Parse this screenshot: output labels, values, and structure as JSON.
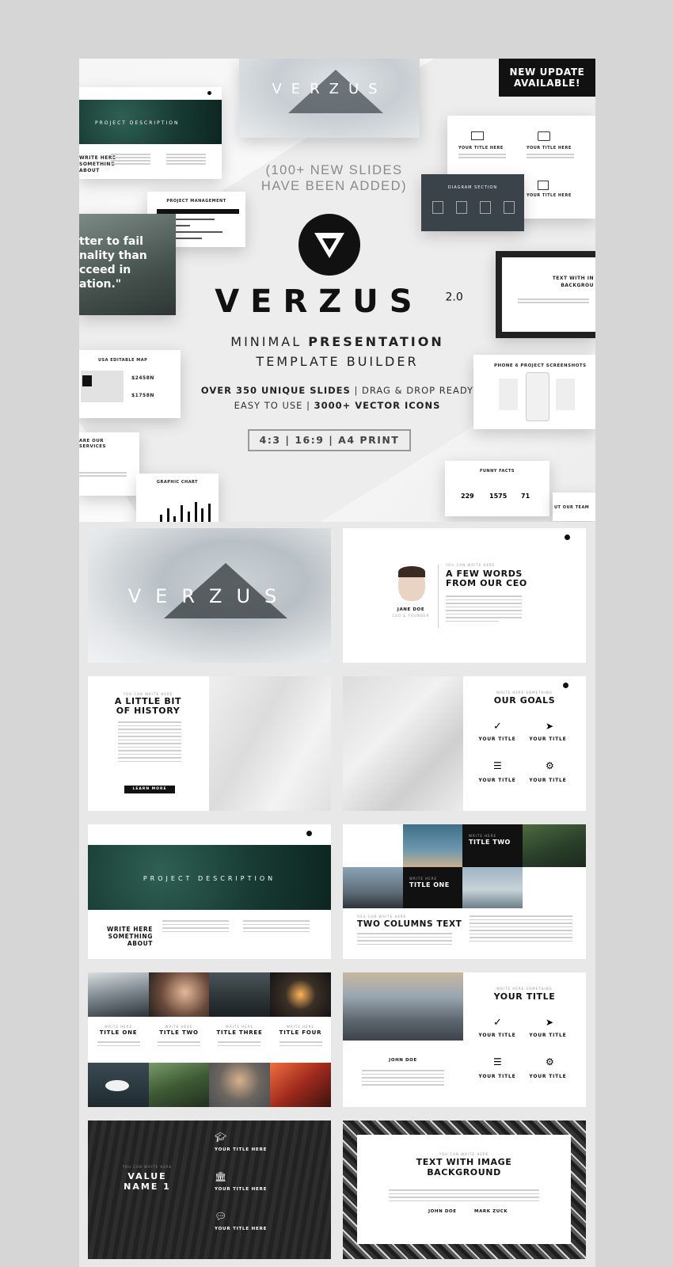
{
  "hero": {
    "badge": [
      "NEW UPDATE",
      "AVAILABLE!"
    ],
    "new_slides": [
      "(100+ NEW SLIDES",
      "HAVE BEEN ADDED)"
    ],
    "brand": "VERZUS",
    "version": "2.0",
    "subtitle_1a": "MINIMAL ",
    "subtitle_1b": "PRESENTATION",
    "subtitle_2": "TEMPLATE BUILDER",
    "features_1a": "OVER 350 UNIQUE SLIDES",
    "features_1b": " | DRAG & DROP READY",
    "features_2a": "EASY TO USE | ",
    "features_2b": "3000+ VECTOR ICONS",
    "ratios": "4:3 | 16:9 | A4 PRINT",
    "cards": {
      "fog_title": "VERZUS",
      "project_desc": "PROJECT DESCRIPTION",
      "write_here": [
        "WRITE HERE",
        "SOMETHING",
        "ABOUT"
      ],
      "project_mgmt": "PROJECT MANAGEMENT",
      "quote": [
        "tter to fail",
        "nality than",
        "cceed in",
        "ation.\""
      ],
      "usa_map": "USA EDITABLE MAP",
      "usa_val1": "$2458N",
      "usa_val2": "$1758N",
      "services": [
        "ARE OUR",
        "SERVICES"
      ],
      "graphic_chart": "GRAPHIC CHART",
      "your_title_here": "YOUR TITLE HERE",
      "diagram_section": "DIAGRAM SECTION",
      "text_with_img": [
        "TEXT WITH IN",
        "BACKGROU"
      ],
      "phone_screens": "PHONE 6 PROJECT SCREENSHOTS",
      "funny_facts": "FUNNY FACTS",
      "facts": [
        "229",
        "1575",
        "71"
      ],
      "our_team": "UT OUR TEAM"
    }
  },
  "slides": {
    "s1_title": "VERZUS",
    "ceo_kicker": "YOU CAN WRITE HERE",
    "ceo_title": [
      "A FEW WORDS",
      "FROM OUR CEO"
    ],
    "ceo_name": "JANE DOE",
    "ceo_role": "CEO & FOUNDER",
    "history_kicker": "YOU CAN WRITE HERE",
    "history_title": [
      "A LITTLE BIT",
      "OF HISTORY"
    ],
    "learn_more": "LEARN MORE",
    "goals_kicker": "WRITE HERE SOMETHING",
    "goals_title": "OUR GOALS",
    "your_title": "YOUR TITLE",
    "project_desc": "PROJECT DESCRIPTION",
    "write_here": [
      "WRITE HERE",
      "SOMETHING",
      "ABOUT"
    ],
    "tc_title_one": "TITLE ONE",
    "tc_title_two": "TITLE TWO",
    "tc_write_here": "WRITE HERE",
    "tc_kicker": "YOU CAN WRITE HERE",
    "tc_heading": "TWO COLUMNS TEXT",
    "four_titles": [
      "TITLE ONE",
      "TITLE TWO",
      "TITLE THREE",
      "TITLE FOUR"
    ],
    "write_here_small": "WRITE HERE",
    "city_name": "JOHN DOE",
    "yt_kicker": "WRITE HERE SOMETHING",
    "yt_title": "YOUR TITLE",
    "value_kicker": "YOU CAN WRITE HERE",
    "value_title": [
      "VALUE",
      "NAME 1"
    ],
    "your_title_here": "YOUR TITLE HERE",
    "twi_kicker": "YOU CAN WRITE HERE",
    "twi_title": [
      "TEXT WITH IMAGE",
      "BACKGROUND"
    ],
    "twi_names": [
      "JOHN DOE",
      "MARK ZUCK"
    ]
  },
  "colors": {
    "accent": "#111111",
    "page_bg": "#d6d6d6"
  }
}
